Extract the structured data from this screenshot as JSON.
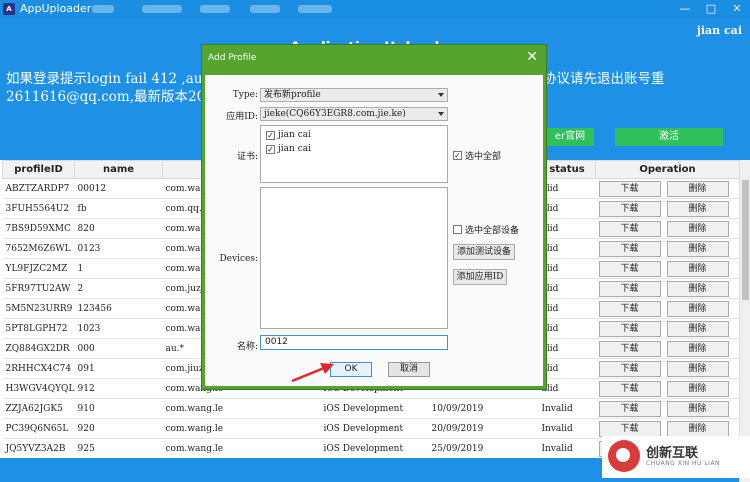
{
  "window": {
    "title": "AppUploader",
    "icon": "A",
    "controls": [
      "—",
      "□",
      "✕"
    ]
  },
  "header": {
    "user": "jian cai",
    "center_title": "Application Uploader",
    "notice": "如果登录提示login fail 412 ,authtype                                                       pple.com/ 然后同意最新的开发协议(如果看不到协议请先退出账号重                                                   2611616@qq.com,最新版本20181018",
    "btn_site": "er官网",
    "btn_activate": "激活"
  },
  "table": {
    "headers": [
      "profileID",
      "name",
      "",
      "",
      "",
      "status",
      "Operation"
    ],
    "download_label": "下载",
    "delete_label": "删除",
    "rows": [
      {
        "id": "ABZTZARDP7",
        "name": "00012",
        "bundle": "com.wang.",
        "type": "",
        "date": "",
        "status": "alid"
      },
      {
        "id": "3FUH5564U2",
        "name": "fb",
        "bundle": "com.qq.jc",
        "type": "",
        "date": "",
        "status": "alid"
      },
      {
        "id": "7BS9D59XMC",
        "name": "820",
        "bundle": "com.wang.",
        "type": "",
        "date": "",
        "status": "alid"
      },
      {
        "id": "7652M6Z6WL",
        "name": "0123",
        "bundle": "com.wang.",
        "type": "",
        "date": "",
        "status": "alid"
      },
      {
        "id": "YL9FJZC2MZ",
        "name": "1",
        "bundle": "com.wang.",
        "type": "",
        "date": "",
        "status": "alid"
      },
      {
        "id": "5FR97TU2AW",
        "name": "2",
        "bundle": "com.juzjia",
        "type": "",
        "date": "",
        "status": "alid"
      },
      {
        "id": "5M5N23URR9",
        "name": "123456",
        "bundle": "com.wang.",
        "type": "",
        "date": "",
        "status": "alid"
      },
      {
        "id": "5PT8LGPH72",
        "name": "1023",
        "bundle": "com.wang.",
        "type": "",
        "date": "",
        "status": "alid"
      },
      {
        "id": "ZQ884GX2DR",
        "name": "000",
        "bundle": "au.*",
        "type": "",
        "date": "",
        "status": "alid"
      },
      {
        "id": "2RHHCX4C74",
        "name": "091",
        "bundle": "com.jiuz.j2",
        "type": "",
        "date": "",
        "status": "alid"
      },
      {
        "id": "H3WGV4QYQL",
        "name": "912",
        "bundle": "com.wang.le",
        "type": "iOS Development",
        "date": "",
        "status": "alid"
      },
      {
        "id": "ZZJA62JGK5",
        "name": "910",
        "bundle": "com.wang.le",
        "type": "iOS Development",
        "date": "10/09/2019",
        "status": "Invalid"
      },
      {
        "id": "PC39Q6N65L",
        "name": "920",
        "bundle": "com.wang.le",
        "type": "iOS Development",
        "date": "20/09/2019",
        "status": "Invalid"
      },
      {
        "id": "JQ5YVZ3A2B",
        "name": "925",
        "bundle": "com.wang.le",
        "type": "iOS Development",
        "date": "25/09/2019",
        "status": "Invalid"
      }
    ]
  },
  "dialog": {
    "title": "Add Profile",
    "close": "✕",
    "type_label": "Type:",
    "type_value": "发布新profile",
    "appid_label": "应用ID:",
    "appid_value": "jieke(CQ66Y3EGR8.com.jie.ke)",
    "cert_label": "证书:",
    "certs": [
      "jian cai",
      "jian cai"
    ],
    "select_all_certs": "选中全部",
    "devices_label": "Devices:",
    "select_all_devices": "选中全部设备",
    "add_test_device": "添加测试设备",
    "add_app_id": "添加应用ID",
    "name_label": "名称:",
    "name_value": "0012",
    "ok": "OK",
    "cancel": "取消"
  },
  "watermark": {
    "cn": "创新互联",
    "en": "CHUANG XIN HU LIAN"
  },
  "colors": {
    "header_blue": "#1e90e6",
    "dialog_green": "#54a42e",
    "button_green": "#2fbf5b",
    "arrow_red": "#e0282e"
  }
}
